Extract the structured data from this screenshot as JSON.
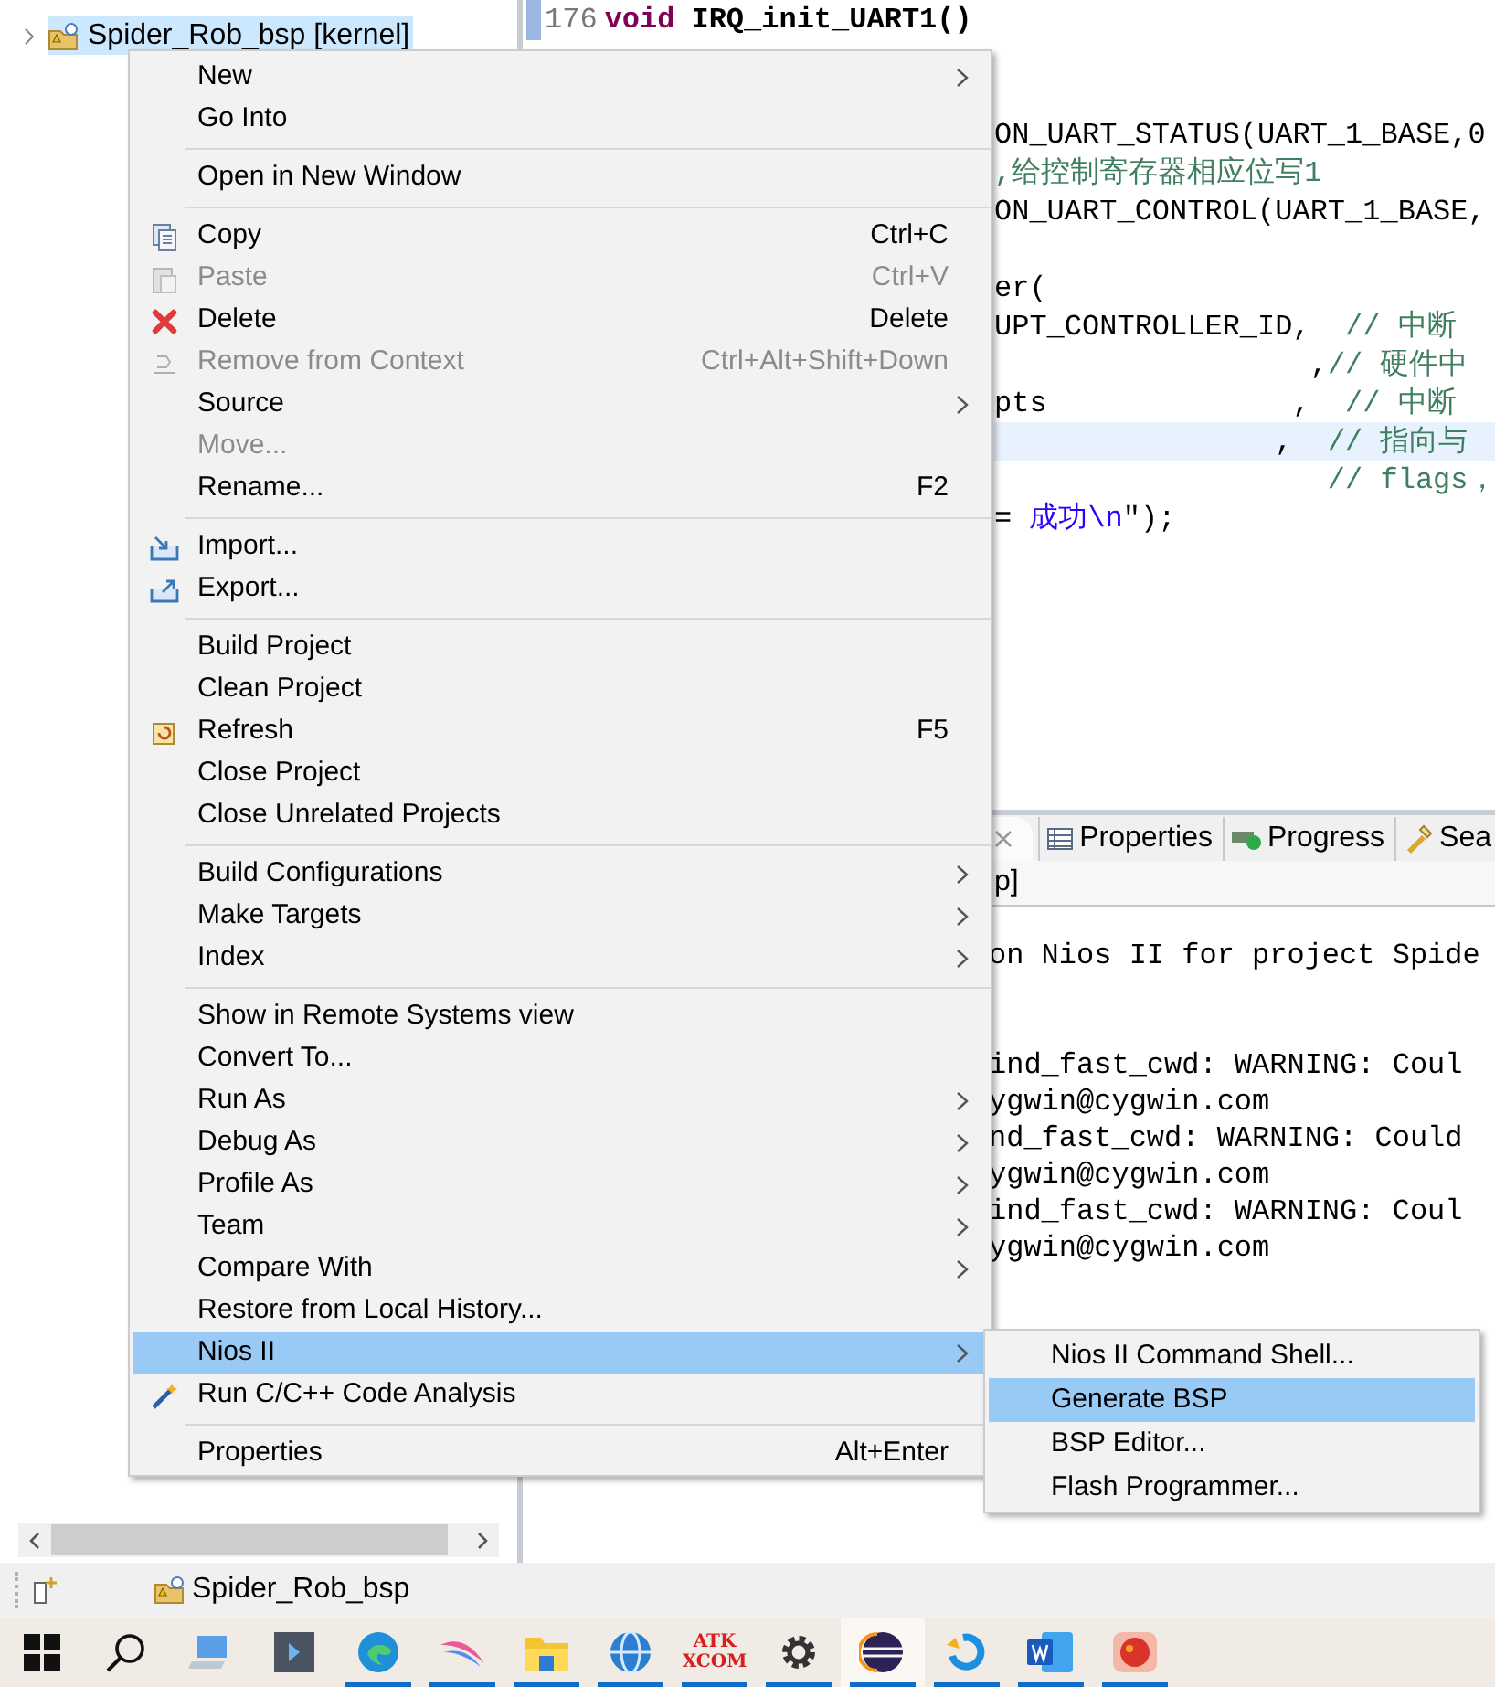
{
  "project_explorer": {
    "items": [
      {
        "label": "Spider_Rob_bsp [kernel]",
        "expanded": false,
        "selected": true
      }
    ]
  },
  "editor": {
    "header": {
      "number": "176",
      "keyword": "void",
      "code": "IRQ_init_UART1()"
    },
    "blocks": [
      [
        {
          "current": false,
          "segments": [
            {
              "kind": "code",
              "text": "ON_UART_STATUS(UART_1_BASE,0"
            }
          ]
        },
        {
          "current": false,
          "segments": [
            {
              "kind": "comment",
              "text": ",给控制寄存器相应位写1"
            }
          ]
        },
        {
          "current": false,
          "segments": [
            {
              "kind": "code",
              "text": "ON_UART_CONTROL(UART_1_BASE,"
            }
          ]
        }
      ],
      [
        {
          "current": false,
          "segments": [
            {
              "kind": "code",
              "text": "er("
            }
          ]
        },
        {
          "current": false,
          "segments": [
            {
              "kind": "code",
              "text": "UPT_CONTROLLER_ID,"
            },
            {
              "kind": "comment",
              "text": "  // 中断"
            }
          ]
        },
        {
          "current": false,
          "segments": [
            {
              "kind": "code",
              "text": "                  ,"
            },
            {
              "kind": "comment",
              "text": "// 硬件中"
            }
          ]
        },
        {
          "current": false,
          "segments": [
            {
              "kind": "code",
              "text": "pts              ,"
            },
            {
              "kind": "comment",
              "text": "  // 中断"
            }
          ]
        },
        {
          "current": true,
          "segments": [
            {
              "kind": "code",
              "text": "                ,"
            },
            {
              "kind": "comment",
              "text": "  // 指向与"
            }
          ]
        },
        {
          "current": false,
          "segments": [
            {
              "kind": "comment",
              "text": "                   // flags，"
            }
          ]
        },
        {
          "current": false,
          "segments": [
            {
              "kind": "code",
              "text": "= "
            },
            {
              "kind": "string",
              "text": "成功\\n"
            },
            {
              "kind": "code",
              "text": "\");"
            }
          ]
        }
      ]
    ]
  },
  "console": {
    "tabs": [
      {
        "label": "Properties",
        "selected": false
      },
      {
        "label": "Progress",
        "selected": false
      },
      {
        "label": "Sea",
        "selected": false
      }
    ],
    "title": "p]",
    "blocks": [
      [
        "on Nios II for project Spide"
      ],
      [
        "ind_fast_cwd: WARNING: Coul",
        "ygwin@cygwin.com",
        "nd_fast_cwd: WARNING: Could",
        "ygwin@cygwin.com",
        "ind_fast_cwd: WARNING: Coul",
        "ygwin@cygwin.com"
      ]
    ]
  },
  "context_menu": {
    "items": [
      {
        "kind": "item",
        "label": "New",
        "submenu": true,
        "disabled": false,
        "selected": false
      },
      {
        "kind": "item",
        "label": "Go Into",
        "submenu": false,
        "disabled": false,
        "selected": false
      },
      {
        "kind": "separator"
      },
      {
        "kind": "item",
        "label": "Open in New Window",
        "submenu": false,
        "disabled": false,
        "selected": false
      },
      {
        "kind": "separator"
      },
      {
        "kind": "item",
        "label": "Copy",
        "shortcut": "Ctrl+C",
        "submenu": false,
        "disabled": false,
        "selected": false
      },
      {
        "kind": "item",
        "label": "Paste",
        "shortcut": "Ctrl+V",
        "submenu": false,
        "disabled": true,
        "selected": false
      },
      {
        "kind": "item",
        "label": "Delete",
        "shortcut": "Delete",
        "submenu": false,
        "disabled": false,
        "selected": false
      },
      {
        "kind": "item",
        "label": "Remove from Context",
        "shortcut": "Ctrl+Alt+Shift+Down",
        "submenu": false,
        "disabled": true,
        "selected": false
      },
      {
        "kind": "item",
        "label": "Source",
        "submenu": true,
        "disabled": false,
        "selected": false
      },
      {
        "kind": "item",
        "label": "Move...",
        "submenu": false,
        "disabled": true,
        "selected": false
      },
      {
        "kind": "item",
        "label": "Rename...",
        "shortcut": "F2",
        "submenu": false,
        "disabled": false,
        "selected": false
      },
      {
        "kind": "separator"
      },
      {
        "kind": "item",
        "label": "Import...",
        "submenu": false,
        "disabled": false,
        "selected": false
      },
      {
        "kind": "item",
        "label": "Export...",
        "submenu": false,
        "disabled": false,
        "selected": false
      },
      {
        "kind": "separator"
      },
      {
        "kind": "item",
        "label": "Build Project",
        "submenu": false,
        "disabled": false,
        "selected": false
      },
      {
        "kind": "item",
        "label": "Clean Project",
        "submenu": false,
        "disabled": false,
        "selected": false
      },
      {
        "kind": "item",
        "label": "Refresh",
        "shortcut": "F5",
        "submenu": false,
        "disabled": false,
        "selected": false
      },
      {
        "kind": "item",
        "label": "Close Project",
        "submenu": false,
        "disabled": false,
        "selected": false
      },
      {
        "kind": "item",
        "label": "Close Unrelated Projects",
        "submenu": false,
        "disabled": false,
        "selected": false
      },
      {
        "kind": "separator"
      },
      {
        "kind": "item",
        "label": "Build Configurations",
        "submenu": true,
        "disabled": false,
        "selected": false
      },
      {
        "kind": "item",
        "label": "Make Targets",
        "submenu": true,
        "disabled": false,
        "selected": false
      },
      {
        "kind": "item",
        "label": "Index",
        "submenu": true,
        "disabled": false,
        "selected": false
      },
      {
        "kind": "separator"
      },
      {
        "kind": "item",
        "label": "Show in Remote Systems view",
        "submenu": false,
        "disabled": false,
        "selected": false
      },
      {
        "kind": "item",
        "label": "Convert To...",
        "submenu": false,
        "disabled": false,
        "selected": false
      },
      {
        "kind": "item",
        "label": "Run As",
        "submenu": true,
        "disabled": false,
        "selected": false
      },
      {
        "kind": "item",
        "label": "Debug As",
        "submenu": true,
        "disabled": false,
        "selected": false
      },
      {
        "kind": "item",
        "label": "Profile As",
        "submenu": true,
        "disabled": false,
        "selected": false
      },
      {
        "kind": "item",
        "label": "Team",
        "submenu": true,
        "disabled": false,
        "selected": false
      },
      {
        "kind": "item",
        "label": "Compare With",
        "submenu": true,
        "disabled": false,
        "selected": false
      },
      {
        "kind": "item",
        "label": "Restore from Local History...",
        "submenu": false,
        "disabled": false,
        "selected": false
      },
      {
        "kind": "item",
        "label": "Nios II",
        "submenu": true,
        "disabled": false,
        "selected": true
      },
      {
        "kind": "item",
        "label": "Run C/C++ Code Analysis",
        "submenu": false,
        "disabled": false,
        "selected": false
      },
      {
        "kind": "separator"
      },
      {
        "kind": "item",
        "label": "Properties",
        "shortcut": "Alt+Enter",
        "submenu": false,
        "disabled": false,
        "selected": false
      }
    ]
  },
  "submenu": {
    "items": [
      {
        "label": "Nios II Command Shell...",
        "selected": false
      },
      {
        "label": "Generate BSP",
        "selected": true
      },
      {
        "label": "BSP Editor...",
        "selected": false
      },
      {
        "label": "Flash Programmer...",
        "selected": false
      }
    ]
  },
  "status_bar": {
    "project": "Spider_Rob_bsp"
  },
  "taskbar": {
    "apps": [
      {
        "running": false,
        "selected": false
      },
      {
        "running": false,
        "selected": false
      },
      {
        "running": true,
        "selected": false
      },
      {
        "running": true,
        "selected": false
      },
      {
        "running": true,
        "selected": false
      },
      {
        "running": true,
        "selected": false
      },
      {
        "running": true,
        "selected": false,
        "logo_lines": [
          "ATK",
          "XCOM"
        ]
      },
      {
        "running": true,
        "selected": false
      },
      {
        "running": true,
        "selected": true
      },
      {
        "running": true,
        "selected": false
      },
      {
        "running": true,
        "selected": false
      },
      {
        "running": true,
        "selected": false
      }
    ]
  }
}
